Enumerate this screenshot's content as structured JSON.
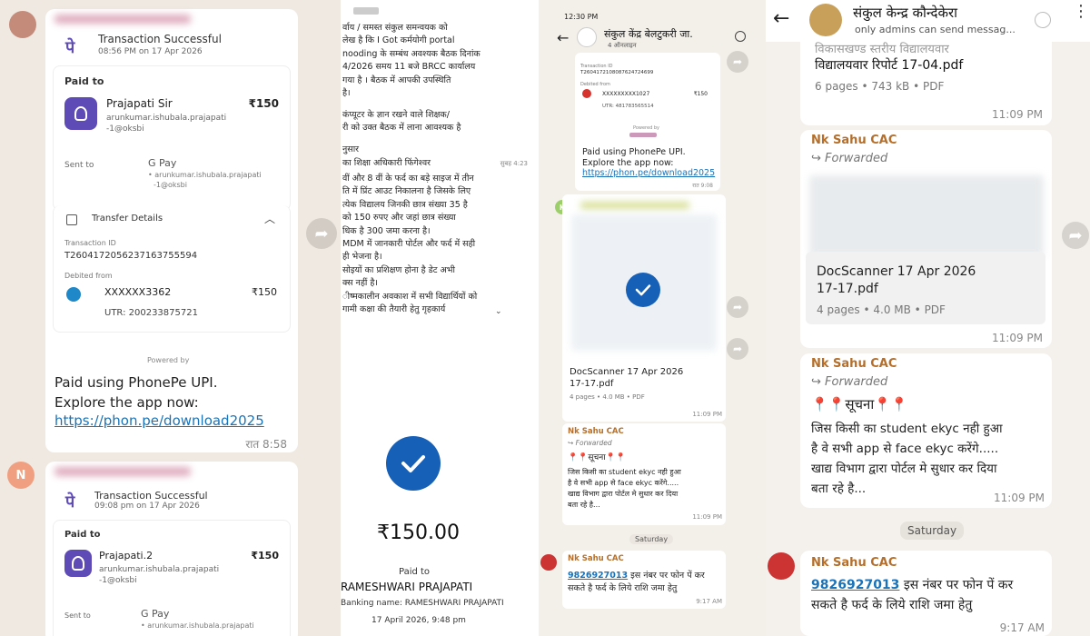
{
  "p1": {
    "txn1": {
      "status": "Transaction Successful",
      "time": "08:56 PM on 17 Apr 2026",
      "paid_to_label": "Paid to",
      "payee_name": "Prajapati Sir",
      "payee_upi": "arunkumar.ishubala.prajapati",
      "payee_upi2": "-1@oksbi",
      "amount": "₹150",
      "sent_to_label": "Sent to",
      "gpay": "G Pay",
      "sent_to_upi": "• arunkumar.ishubala.prajapati",
      "sent_to_upi2": "-1@oksbi",
      "transfer_details": "Transfer Details",
      "txn_id_label": "Transaction ID",
      "txn_id": "T2604172056237163755594",
      "debited_label": "Debited from",
      "account": "XXXXXX3362",
      "debit_amount": "₹150",
      "utr": "UTR: 200233875721",
      "powered_by": "Powered by"
    },
    "msg1": {
      "line1": "Paid using PhonePe UPI.",
      "line2": "Explore the app now:",
      "link": "https://phon.pe/download2025",
      "time": "रात 8:58"
    },
    "avatar_letter": "N",
    "txn2": {
      "status": "Transaction Successful",
      "time": "09:08 pm on 17 Apr 2026",
      "paid_to_label": "Paid to",
      "payee_name": "Prajapati.2",
      "payee_upi": "arunkumar.ishubala.prajapati",
      "payee_upi2": "-1@oksbi",
      "amount": "₹150",
      "sent_to_label": "Sent to",
      "gpay": "G Pay",
      "sent_to_upi": "• arunkumar.ishubala.prajapati"
    }
  },
  "p2": {
    "lines": [
      "र्वाय / समस्त संकुल समन्वयक को",
      "लेख है कि I Got  कर्मयोगी portal",
      "nooding के सम्बंध अवश्यक बैठक दिनांक",
      "4/2026 समय 11 बजे BRCC कार्यालय",
      "गया है । बैठक में आपकी उपस्थिति",
      "है।",
      "",
      "कंप्यूटर के ज्ञान रखने वाले शिक्षक/",
      "री को उक्त बैठक में लाना आवश्यक है",
      "",
      "नुसार",
      "का शिक्षा अधिकारी फिंगेश्वर"
    ],
    "time1": "सुबह 4:23",
    "lines2": [
      "वीं और 8 वीं के फर्द का बड़े साइज में तीन",
      "ति में प्रिंट आउट निकालना है जिसके लिए",
      "त्येक विद्यालय जिनकी छात्र संख्या 35 है",
      "को 150 रुपए और जहां छात्र संख्या",
      "धिक है 300 जमा करना है।",
      "MDM में जानकारी पोर्टल और फर्द में सही",
      "ही भेजना है।",
      "सोइयों का प्रशिक्षण होना है डेट अभी",
      "क्स नहीं है।",
      "ीष्मकालीन अवकाश में सभी विद्यार्थियों को",
      "गामी कक्षा की तैयारी हेतु गृहकार्य"
    ],
    "amount": "₹150.00",
    "paid_to": "Paid to",
    "payee": "RAMESHWARI PRAJAPATI",
    "banking_name": "Banking name: RAMESHWARI PRAJAPATI",
    "date": "17 April 2026, 9:48 pm"
  },
  "p3": {
    "status_time": "12:30 PM",
    "header_title": "संकुल केंद्र बेलटुकरी जा.",
    "header_sub": "4 ऑनलाइन",
    "receipt": {
      "txn_label": "Transaction ID",
      "txn_id": "T2604172108087624724699",
      "debited": "Debited from",
      "account": "XXXXXXXXX1027",
      "amount": "₹150",
      "utr": "UTR: 481783565514",
      "powered": "Powered by"
    },
    "msg_line1": "Paid using PhonePe UPI.",
    "msg_line2": "Explore the app now:",
    "msg_link": "https://phon.pe/download2025",
    "msg_time": "रात 9:08",
    "k_avatar": "K",
    "doc_name": "DocScanner 17 Apr 2026",
    "doc_name2": "17-17.pdf",
    "doc_meta": "4 pages • 4.0 MB • PDF",
    "doc_time": "11:09 PM",
    "sender": "Nk Sahu CAC",
    "forwarded": "Forwarded",
    "suchna": "📍📍सूचना📍📍",
    "msg2_lines": [
      "जिस किसी का  student ekyc नही हुआ",
      "है वे सभी app से face ekyc करेंगे.....",
      "खाद्य विभाग द्वारा पोर्टल मे सुधार कर दिया",
      "बता रहे है..."
    ],
    "msg2_time": "11:09 PM",
    "day": "Saturday",
    "sender2": "Nk Sahu CAC",
    "phone": "9826927013",
    "msg3_rest": " इस नंबर पर फोन पें कर",
    "msg3_line2": "सकते है फर्द के लिये राशि जमा हेतु",
    "msg3_time": "9:17 AM"
  },
  "p4": {
    "header_title": "संकुल केन्द्र कौन्देकेरा",
    "header_sub": "only admins can send messag...",
    "doc1_title_top": "विकासखण्ड स्तरीय विद्यालयवार",
    "doc1_title": "विद्यालयवार रिपोर्ट 17-04.pdf",
    "doc1_meta": "6 pages • 743 kB • PDF",
    "doc1_time": "11:09 PM",
    "sender": "Nk Sahu CAC",
    "forwarded": "Forwarded",
    "doc2_title": "DocScanner 17 Apr 2026",
    "doc2_title2": "17-17.pdf",
    "doc2_meta": "4 pages • 4.0 MB • PDF",
    "doc2_time": "11:09 PM",
    "sender2": "Nk Sahu CAC",
    "forwarded2": "Forwarded",
    "suchna": "📍📍सूचना📍📍",
    "msg_lines": [
      "जिस किसी का  student ekyc नही हुआ",
      "है वे सभी app से face ekyc करेंगे.....",
      "खाद्य विभाग द्वारा पोर्टल मे सुधार कर दिया",
      "बता रहे है..."
    ],
    "msg_time": "11:09 PM",
    "day": "Saturday",
    "sender3": "Nk Sahu CAC",
    "phone": "9826927013",
    "msg2_rest": " इस नंबर पर फोन पें कर",
    "msg2_line2": "सकते है फर्द के लिये राशि जमा हेतु",
    "msg2_time": "9:17 AM"
  }
}
